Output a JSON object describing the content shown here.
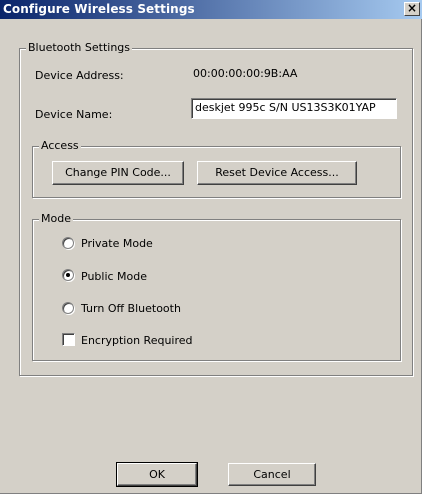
{
  "window": {
    "title": "Configure Wireless Settings",
    "close_label": "×"
  },
  "bluetooth": {
    "group_label": "Bluetooth Settings",
    "device_address_label": "Device Address:",
    "device_address_value": "00:00:00:00:9B:AA",
    "device_name_label": "Device Name:",
    "device_name_value": "deskjet 995c S/N US13S3K01YAP"
  },
  "access": {
    "group_label": "Access",
    "change_pin_label": "Change PIN Code...",
    "reset_access_label": "Reset Device Access..."
  },
  "mode": {
    "group_label": "Mode",
    "options": [
      {
        "label": "Private Mode",
        "selected": false
      },
      {
        "label": "Public Mode",
        "selected": true
      },
      {
        "label": "Turn Off Bluetooth",
        "selected": false
      }
    ],
    "encryption_label": "Encryption Required",
    "encryption_checked": false
  },
  "footer": {
    "ok_label": "OK",
    "cancel_label": "Cancel"
  }
}
